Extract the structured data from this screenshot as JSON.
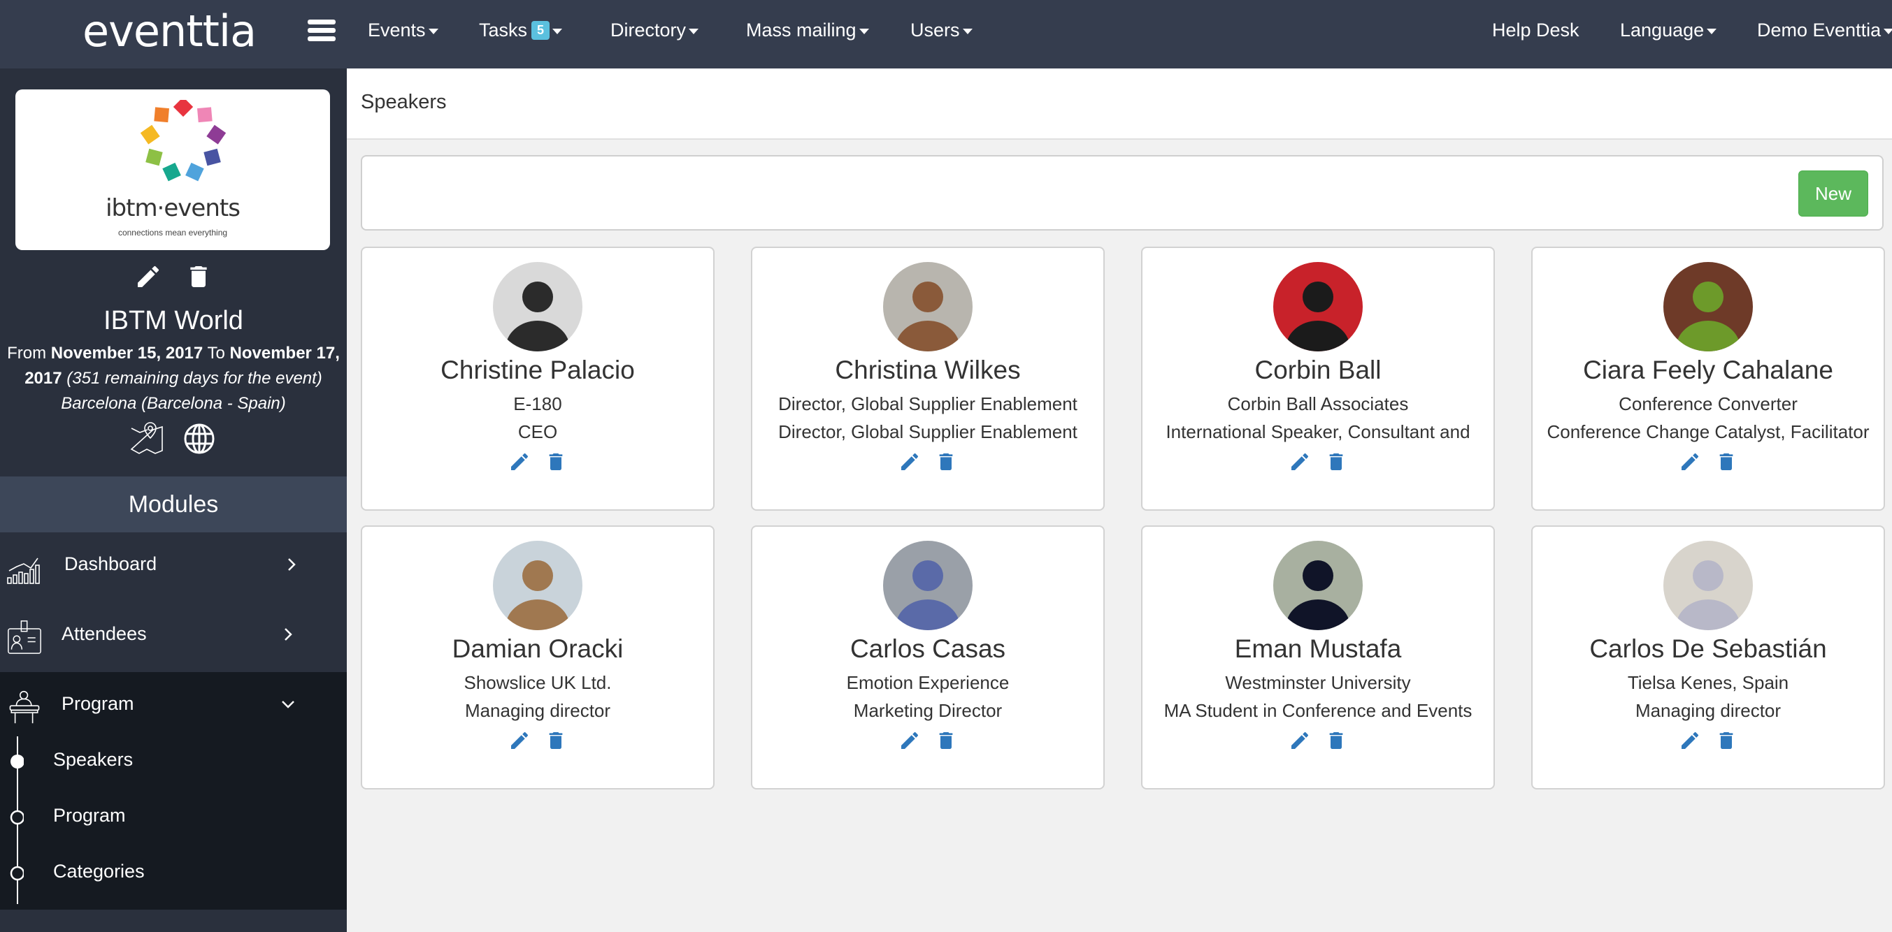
{
  "topbar": {
    "brand": "eventtia",
    "nav": [
      {
        "label": "Events",
        "has_caret": true
      },
      {
        "label": "Tasks",
        "badge": "5",
        "has_caret": true
      },
      {
        "label": "Directory",
        "has_caret": true
      },
      {
        "label": "Mass mailing",
        "has_caret": true
      },
      {
        "label": "Users",
        "has_caret": true
      }
    ],
    "right": [
      {
        "label": "Help Desk",
        "has_caret": false
      },
      {
        "label": "Language",
        "has_caret": true
      },
      {
        "label": "Demo Eventtia",
        "has_caret": true
      }
    ]
  },
  "sidebar": {
    "logo": {
      "text": "ibtm·events",
      "tagline": "connections mean everything"
    },
    "event": {
      "title": "IBTM World",
      "from_label": "From",
      "start_date": "November 15, 2017",
      "to_label": "To",
      "end_date": "November 17, 2017",
      "remaining": "(351 remaining days for the event)",
      "location": "Barcelona (Barcelona - Spain)"
    },
    "modules_title": "Modules",
    "modules": [
      {
        "label": "Dashboard",
        "icon": "chart-icon",
        "state": "collapsed"
      },
      {
        "label": "Attendees",
        "icon": "badge-icon",
        "state": "collapsed"
      },
      {
        "label": "Program",
        "icon": "podium-icon",
        "state": "expanded",
        "children": [
          {
            "label": "Speakers",
            "active": true
          },
          {
            "label": "Program",
            "active": false
          },
          {
            "label": "Categories",
            "active": false
          }
        ]
      }
    ]
  },
  "main": {
    "page_title": "Speakers",
    "new_button": "New",
    "speakers": [
      {
        "name": "Christine Palacio",
        "company": "E-180",
        "position": "CEO",
        "avatar_bg": "#d9d9d9",
        "avatar_fg": "#2b2b2b"
      },
      {
        "name": "Christina Wilkes",
        "company": "Director, Global Supplier Enablement",
        "position": "Director, Global Supplier Enablement",
        "avatar_bg": "#b8b5ae",
        "avatar_fg": "#8a5a3a"
      },
      {
        "name": "Corbin Ball",
        "company": "Corbin Ball Associates",
        "position": "International Speaker, Consultant and",
        "avatar_bg": "#c8222a",
        "avatar_fg": "#1b1b1b"
      },
      {
        "name": "Ciara Feely Cahalane",
        "company": "Conference Converter",
        "position": "Conference Change Catalyst, Facilitator",
        "avatar_bg": "#6e3a28",
        "avatar_fg": "#6d9a2a"
      },
      {
        "name": "Damian Oracki",
        "company": "Showslice UK Ltd.",
        "position": "Managing director",
        "avatar_bg": "#c9d3da",
        "avatar_fg": "#a07850"
      },
      {
        "name": "Carlos Casas",
        "company": "Emotion Experience",
        "position": "Marketing Director",
        "avatar_bg": "#9aa0a8",
        "avatar_fg": "#5a6aa8"
      },
      {
        "name": "Eman Mustafa",
        "company": "Westminster University",
        "position": "MA Student in Conference and Events",
        "avatar_bg": "#a8b0a0",
        "avatar_fg": "#101428"
      },
      {
        "name": "Carlos De Sebastián",
        "company": "Tielsa Kenes, Spain",
        "position": "Managing director",
        "avatar_bg": "#d8d4cc",
        "avatar_fg": "#b8b8c8"
      }
    ]
  },
  "colors": {
    "topbar": "#353d4e",
    "sidebar": "#2a303d",
    "modules_header": "#3d4759",
    "active_section": "#151a21",
    "primary_icon": "#2e77bb",
    "success": "#5cb85c",
    "badge": "#5bc0de"
  }
}
